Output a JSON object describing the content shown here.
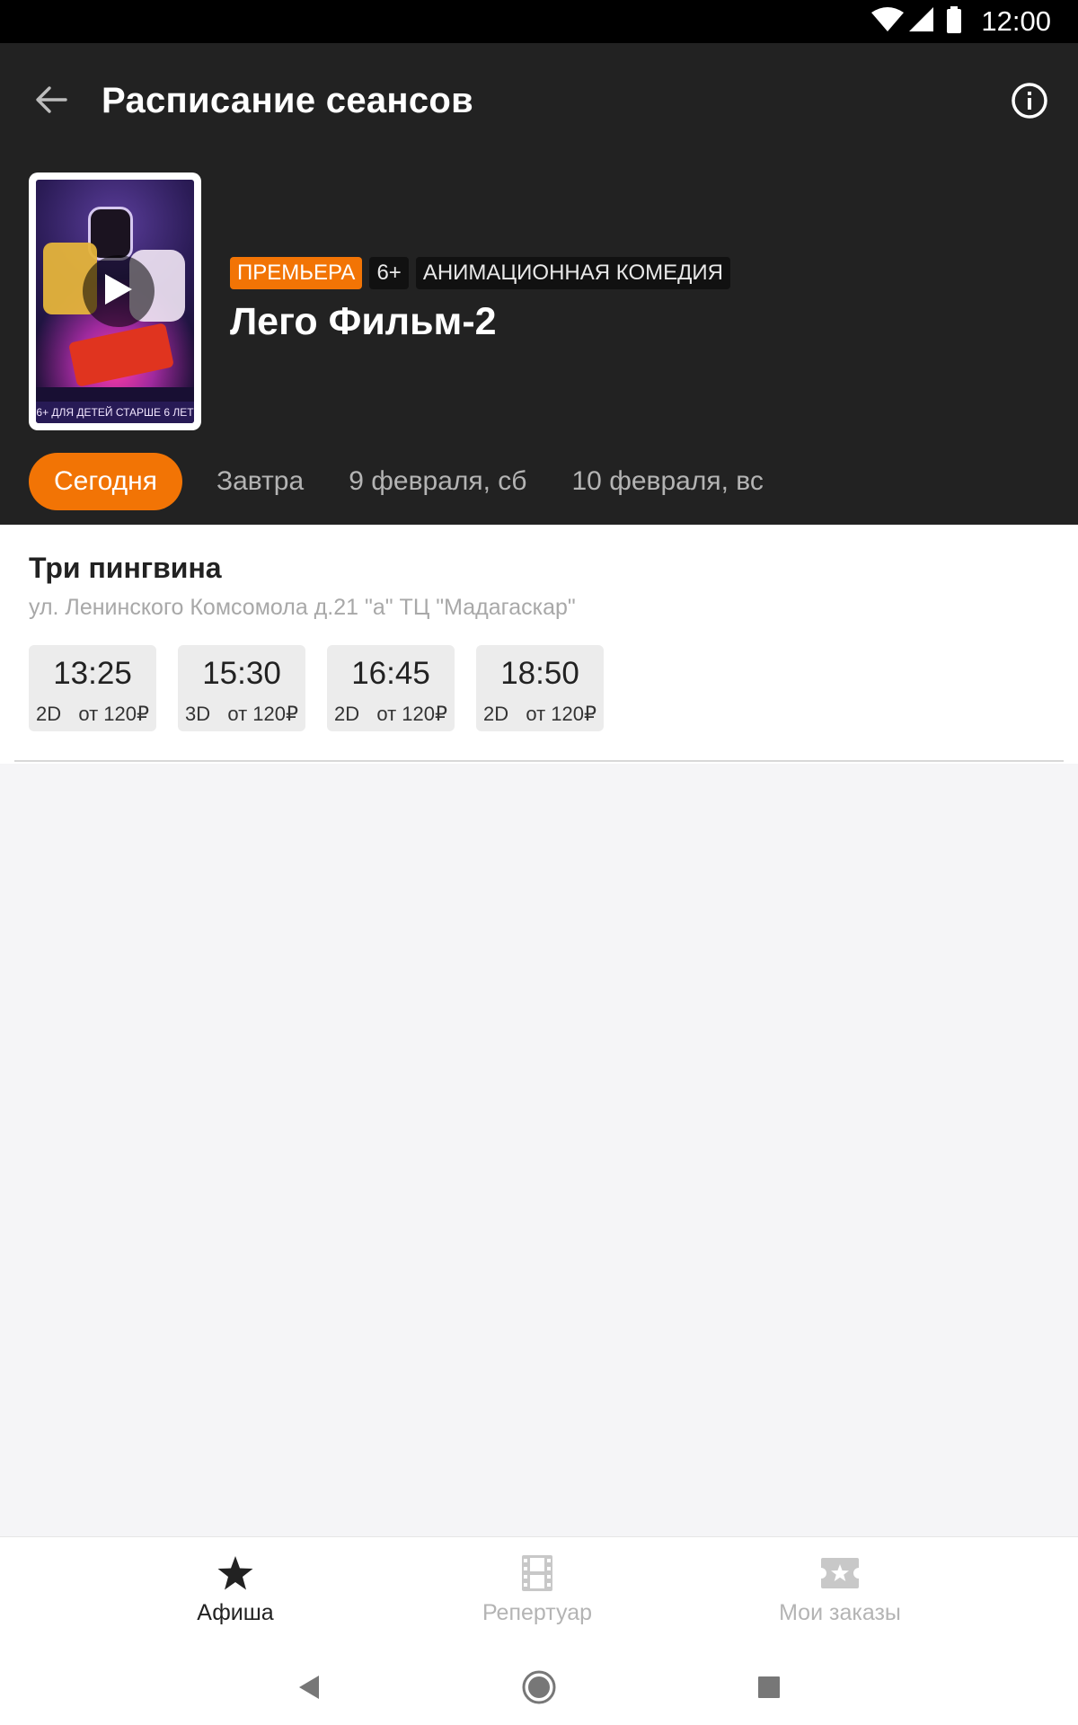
{
  "status_bar": {
    "time": "12:00",
    "icons": [
      "wifi-icon",
      "signal-icon",
      "battery-icon"
    ]
  },
  "toolbar": {
    "title": "Расписание сеансов",
    "back_icon": "arrow-left-icon",
    "info_icon": "info-icon"
  },
  "movie": {
    "title": "Лего Фильм-2",
    "tags": {
      "premiere": "ПРЕМЬЕРА",
      "age": "6+",
      "genre": "АНИМАЦИОННАЯ КОМЕДИЯ"
    },
    "poster_footer": "6+ ДЛЯ ДЕТЕЙ СТАРШЕ 6 ЛЕТ"
  },
  "date_tabs": [
    "Сегодня",
    "Завтра",
    "9 февраля, сб",
    "10 февраля, вс"
  ],
  "cinema": {
    "name": "Три пингвина",
    "address": "ул. Ленинского Комсомола д.21 \"а\" ТЦ \"Мадагаскар\"",
    "sessions": [
      {
        "time": "13:25",
        "format": "2D",
        "price": "от 120₽"
      },
      {
        "time": "15:30",
        "format": "3D",
        "price": "от 120₽"
      },
      {
        "time": "16:45",
        "format": "2D",
        "price": "от 120₽"
      },
      {
        "time": "18:50",
        "format": "2D",
        "price": "от 120₽"
      }
    ]
  },
  "bottom_nav": [
    {
      "label": "Афиша",
      "icon": "star-icon"
    },
    {
      "label": "Репертуар",
      "icon": "film-icon"
    },
    {
      "label": "Мои заказы",
      "icon": "ticket-icon"
    }
  ],
  "colors": {
    "accent": "#f27405",
    "header_bg": "#222222",
    "page_bg": "#f5f5f7"
  }
}
